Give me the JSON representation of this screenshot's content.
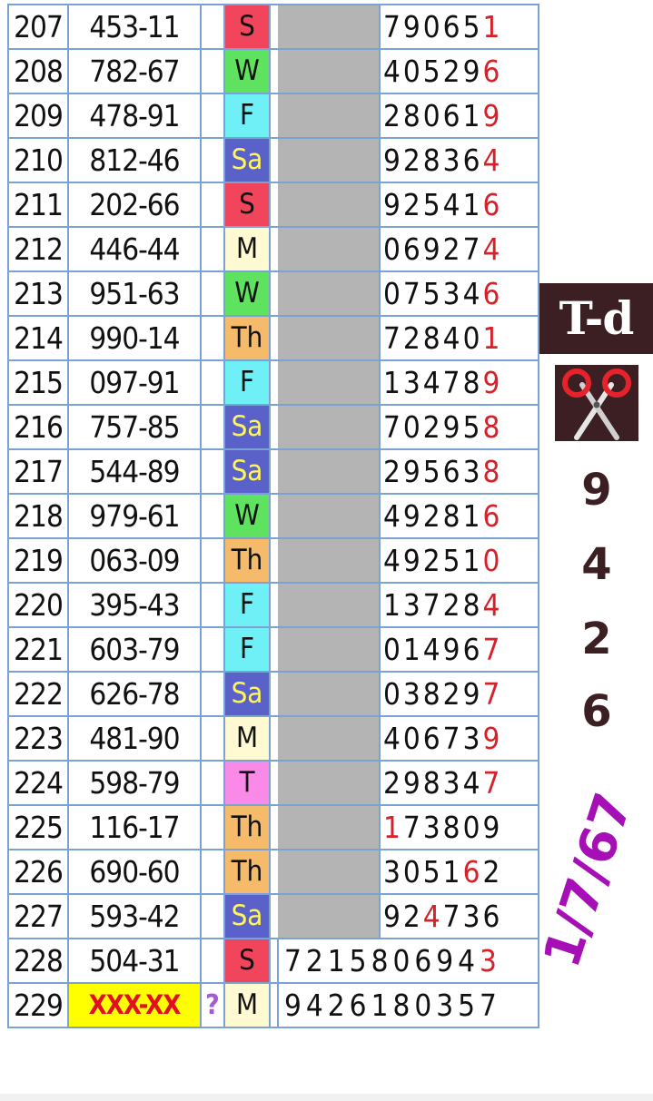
{
  "rows": [
    {
      "no": "207",
      "code": "453-11",
      "day": "S",
      "digits": "790651",
      "red": [
        5
      ]
    },
    {
      "no": "208",
      "code": "782-67",
      "day": "W",
      "digits": "405296",
      "red": [
        5
      ]
    },
    {
      "no": "209",
      "code": "478-91",
      "day": "F",
      "digits": "280619",
      "red": [
        5
      ]
    },
    {
      "no": "210",
      "code": "812-46",
      "day": "Sa",
      "digits": "928364",
      "red": [
        5
      ]
    },
    {
      "no": "211",
      "code": "202-66",
      "day": "S",
      "digits": "925416",
      "red": [
        5
      ]
    },
    {
      "no": "212",
      "code": "446-44",
      "day": "M",
      "digits": "069274",
      "red": [
        5
      ]
    },
    {
      "no": "213",
      "code": "951-63",
      "day": "W",
      "digits": "075346",
      "red": [
        5
      ]
    },
    {
      "no": "214",
      "code": "990-14",
      "day": "Th",
      "digits": "728401",
      "red": [
        5
      ]
    },
    {
      "no": "215",
      "code": "097-91",
      "day": "F",
      "digits": "134789",
      "red": [
        5
      ]
    },
    {
      "no": "216",
      "code": "757-85",
      "day": "Sa",
      "digits": "702958",
      "red": [
        5
      ]
    },
    {
      "no": "217",
      "code": "544-89",
      "day": "Sa",
      "digits": "295638",
      "red": [
        5
      ]
    },
    {
      "no": "218",
      "code": "979-61",
      "day": "W",
      "digits": "492816",
      "red": [
        5
      ]
    },
    {
      "no": "219",
      "code": "063-09",
      "day": "Th",
      "digits": "492510",
      "red": [
        5
      ]
    },
    {
      "no": "220",
      "code": "395-43",
      "day": "F",
      "digits": "137284",
      "red": [
        5
      ]
    },
    {
      "no": "221",
      "code": "603-79",
      "day": "F",
      "digits": "014967",
      "red": [
        5
      ]
    },
    {
      "no": "222",
      "code": "626-78",
      "day": "Sa",
      "digits": "038297",
      "red": [
        5
      ]
    },
    {
      "no": "223",
      "code": "481-90",
      "day": "M",
      "digits": "406739",
      "red": [
        5
      ]
    },
    {
      "no": "224",
      "code": "598-79",
      "day": "T",
      "digits": "298347",
      "red": [
        5
      ]
    },
    {
      "no": "225",
      "code": "116-17",
      "day": "Th",
      "digits": "173809",
      "red": [
        0
      ]
    },
    {
      "no": "226",
      "code": "690-60",
      "day": "Th",
      "digits": "305162",
      "red": [
        4
      ]
    },
    {
      "no": "227",
      "code": "593-42",
      "day": "Sa",
      "digits": "924736",
      "red": [
        2
      ]
    },
    {
      "no": "228",
      "code": "504-31",
      "day": "S",
      "digits": "7215806943",
      "red": [
        9
      ],
      "wide": true
    },
    {
      "no": "229",
      "code": "XXX-XX",
      "day": "M",
      "digits": "9426180357",
      "red": [],
      "wide": true,
      "unknown": true,
      "mark": "?"
    }
  ],
  "side": {
    "badge": "T-d",
    "scissors_icon": "scissors-icon",
    "picks": [
      "9",
      "4",
      "2",
      "6"
    ],
    "date": "1/7/67"
  },
  "colors": {
    "S": "#f0455a",
    "W": "#5fe25f",
    "F": "#6ff0f6",
    "Sa": "#5a62c9",
    "M": "#fffad2",
    "Th": "#f6bb6a",
    "T": "#f98ae8",
    "grid": "#7aa2d2",
    "red_digit": "#d4212a",
    "date": "#a50fb5",
    "badge_bg": "#3b1f22"
  }
}
